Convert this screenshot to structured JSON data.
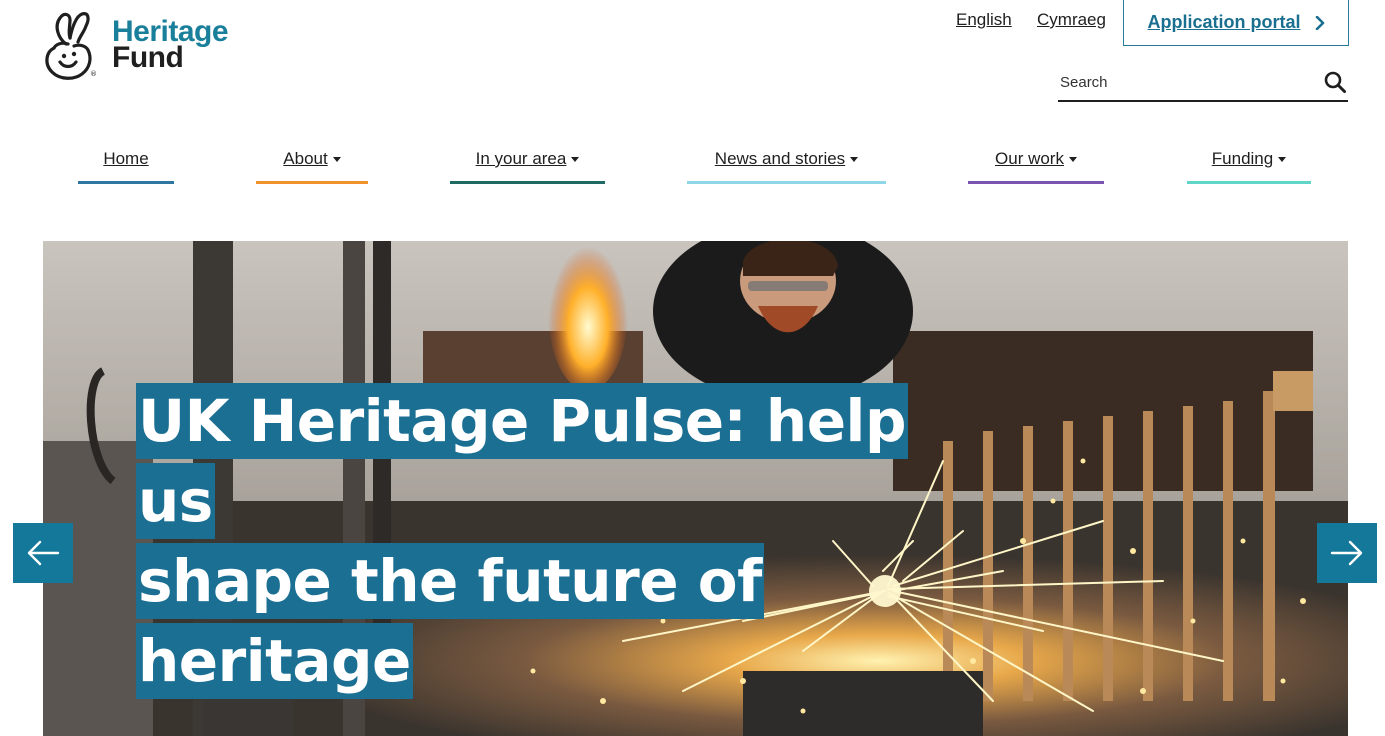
{
  "logo": {
    "line1": "Heritage",
    "line2": "Fund"
  },
  "header": {
    "languages": [
      {
        "label": "English"
      },
      {
        "label": "Cymraeg"
      }
    ],
    "portal_label": "Application portal",
    "search_placeholder": "Search"
  },
  "nav": {
    "items": [
      {
        "label": "Home",
        "has_dropdown": false,
        "accent": "#2f77a0"
      },
      {
        "label": "About",
        "has_dropdown": true,
        "accent": "#f0922b"
      },
      {
        "label": "In your area",
        "has_dropdown": true,
        "accent": "#1f6a62"
      },
      {
        "label": "News and stories",
        "has_dropdown": true,
        "accent": "#8fd6e6"
      },
      {
        "label": "Our work",
        "has_dropdown": true,
        "accent": "#7a55b0"
      },
      {
        "label": "Funding",
        "has_dropdown": true,
        "accent": "#5fd6c8"
      }
    ]
  },
  "hero": {
    "headline_lines": [
      "UK Heritage Pulse: help us",
      "shape the future of",
      "heritage"
    ],
    "headline_bg": "#1b6f93"
  },
  "colors": {
    "brand_teal": "#1a7f9a",
    "arrow_bg": "#14789a"
  },
  "icons": {
    "logo": "crossed-fingers-hand-icon",
    "portal": "chevron-right-icon",
    "search": "search-icon",
    "prev": "arrow-left-icon",
    "next": "arrow-right-icon"
  }
}
